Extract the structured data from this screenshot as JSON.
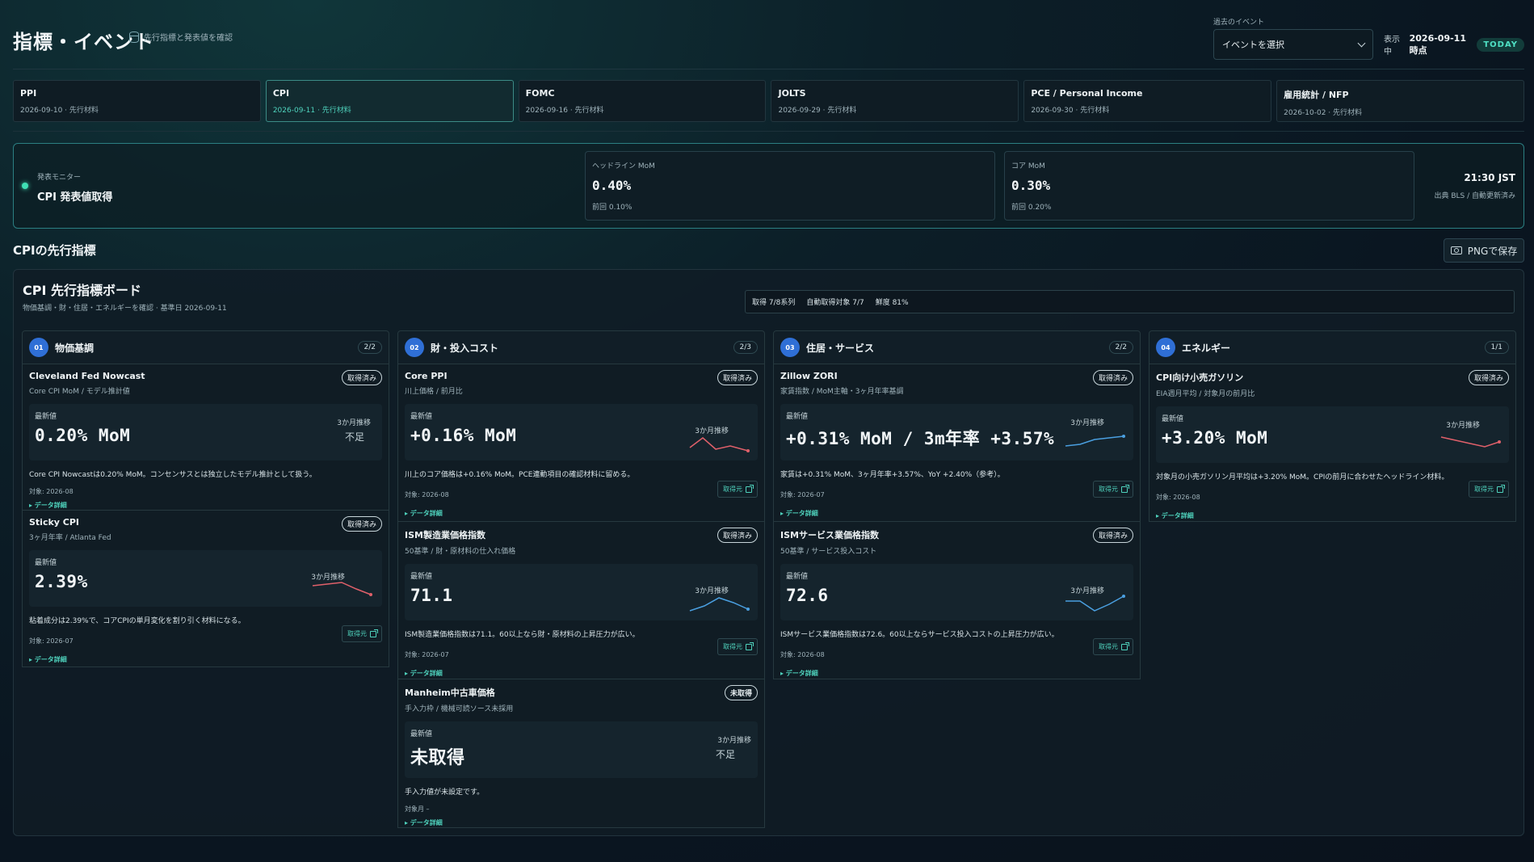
{
  "header": {
    "title": "指標・イベント",
    "subtitle": "先行指標と発表値を確認",
    "past_events_label": "過去のイベント",
    "past_events_select": "イベントを選択",
    "showing_label": "表示中",
    "showing_date": "2026-09-11 時点",
    "today_badge": "TODAY"
  },
  "tabs": [
    {
      "name": "PPI",
      "meta": "2026-09-10 · 先行材料"
    },
    {
      "name": "CPI",
      "meta": "2026-09-11 · 先行材料",
      "active": true
    },
    {
      "name": "FOMC",
      "meta": "2026-09-16 · 先行材料"
    },
    {
      "name": "JOLTS",
      "meta": "2026-09-29 · 先行材料"
    },
    {
      "name": "PCE / Personal Income",
      "meta": "2026-09-30 · 先行材料"
    },
    {
      "name": "雇用統計 / NFP",
      "meta": "2026-10-02 · 先行材料"
    }
  ],
  "monitor": {
    "label": "発表モニター",
    "title": "CPI 発表値取得",
    "headline_label": "ヘッドライン MoM",
    "headline_value": "0.40%",
    "headline_prev": "前回 0.10%",
    "core_label": "コア MoM",
    "core_value": "0.30%",
    "core_prev": "前回 0.20%",
    "time": "21:30 JST",
    "source": "出典 BLS / 自動更新済み"
  },
  "section": {
    "title": "CPIの先行指標",
    "png_button": "PNGで保存"
  },
  "board": {
    "title": "CPI 先行指標ボード",
    "subtitle": "物価基調・財・住居・エネルギーを確認 · 基準日 2026-09-11",
    "stat1": "取得 7/8系列",
    "stat2": "自動取得対象 7/7",
    "stat3": "鮮度 81%"
  },
  "common": {
    "latest": "最新値",
    "trend": "3か月推移",
    "detail": "▸ データ詳細",
    "source_btn": "取得元"
  },
  "columns": [
    {
      "num": "01",
      "name": "物価基調",
      "count": "2/2",
      "cards": [
        {
          "name": "Cleveland Fed Nowcast",
          "sub": "Core CPI MoM / モデル推計値",
          "status": "取得済み",
          "value": "0.20% MoM",
          "insufficient": "不足",
          "desc": "Core CPI Nowcastは0.20% MoM。コンセンサスとは独立したモデル推計として扱う。",
          "target": "対象: 2026-08"
        },
        {
          "name": "Sticky CPI",
          "sub": "3ヶ月年率 / Atlanta Fed",
          "status": "取得済み",
          "value": "2.39%",
          "desc": "粘着成分は2.39%で、コアCPIの単月変化を割り引く材料になる。",
          "target": "対象: 2026-07",
          "spark_color": "#e0606a"
        }
      ]
    },
    {
      "num": "02",
      "name": "財・投入コスト",
      "count": "2/3",
      "cards": [
        {
          "name": "Core PPI",
          "sub": "川上価格 / 前月比",
          "status": "取得済み",
          "value": "+0.16% MoM",
          "desc": "川上のコア価格は+0.16% MoM。PCE連動項目の確認材料に留める。",
          "target": "対象: 2026-08",
          "spark_color": "#e0606a"
        },
        {
          "name": "ISM製造業価格指数",
          "sub": "50基準 / 財・原材料の仕入れ価格",
          "status": "取得済み",
          "value": "71.1",
          "desc": "ISM製造業価格指数は71.1。60以上なら財・原材料の上昇圧力が広い。",
          "target": "対象: 2026-07",
          "spark_color": "#4a9fe0"
        },
        {
          "name": "Manheim中古車価格",
          "sub": "手入力枠 / 機械可読ソース未採用",
          "status": "未取得",
          "value": "未取得",
          "insufficient": "不足",
          "desc": "手入力値が未設定です。",
          "target": "対象月 –"
        }
      ]
    },
    {
      "num": "03",
      "name": "住居・サービス",
      "count": "2/2",
      "cards": [
        {
          "name": "Zillow ZORI",
          "sub": "家賃指数 / MoM主軸・3ヶ月年率基調",
          "status": "取得済み",
          "value": "+0.31% MoM / 3m年率 +3.57%",
          "desc": "家賃は+0.31% MoM、3ヶ月年率+3.57%、YoY +2.40%（参考）。",
          "target": "対象: 2026-07",
          "spark_color": "#4a9fe0"
        },
        {
          "name": "ISMサービス業価格指数",
          "sub": "50基準 / サービス投入コスト",
          "status": "取得済み",
          "value": "72.6",
          "desc": "ISMサービス業価格指数は72.6。60以上ならサービス投入コストの上昇圧力が広い。",
          "target": "対象: 2026-08",
          "spark_color": "#4a9fe0"
        }
      ]
    },
    {
      "num": "04",
      "name": "エネルギー",
      "count": "1/1",
      "cards": [
        {
          "name": "CPI向け小売ガソリン",
          "sub": "EIA週月平均 / 対象月の前月比",
          "status": "取得済み",
          "value": "+3.20% MoM",
          "desc": "対象月の小売ガソリン月平均は+3.20% MoM。CPIの前月に合わせたヘッドライン材料。",
          "target": "対象: 2026-08",
          "spark_color": "#e0606a"
        }
      ]
    }
  ]
}
